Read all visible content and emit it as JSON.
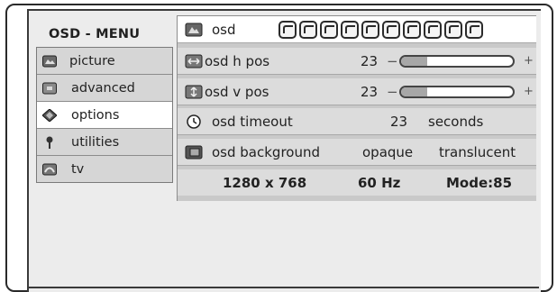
{
  "menu_title": "OSD - MENU",
  "sidebar": {
    "items": [
      {
        "label": "picture",
        "icon": "picture-icon",
        "active": false
      },
      {
        "label": "advanced",
        "icon": "advanced-icon",
        "active": false
      },
      {
        "label": "options",
        "icon": "options-icon",
        "active": true
      },
      {
        "label": "utilities",
        "icon": "utilities-icon",
        "active": false
      },
      {
        "label": "tv",
        "icon": "tv-icon",
        "active": false
      }
    ]
  },
  "options": {
    "osd": {
      "label": "osd",
      "language_buttons": 10
    },
    "h_pos": {
      "label": "osd h pos",
      "value": "23",
      "minus": "−",
      "plus": "+",
      "level": 0.23
    },
    "v_pos": {
      "label": "osd v pos",
      "value": "23",
      "minus": "−",
      "plus": "+",
      "level": 0.23
    },
    "timeout": {
      "label": "osd timeout",
      "value": "23",
      "unit": "seconds"
    },
    "background": {
      "label": "osd background",
      "option1": "opaque",
      "option2": "translucent"
    }
  },
  "status": {
    "resolution": "1280 x 768",
    "frequency": "60 Hz",
    "mode": "Mode:85"
  }
}
